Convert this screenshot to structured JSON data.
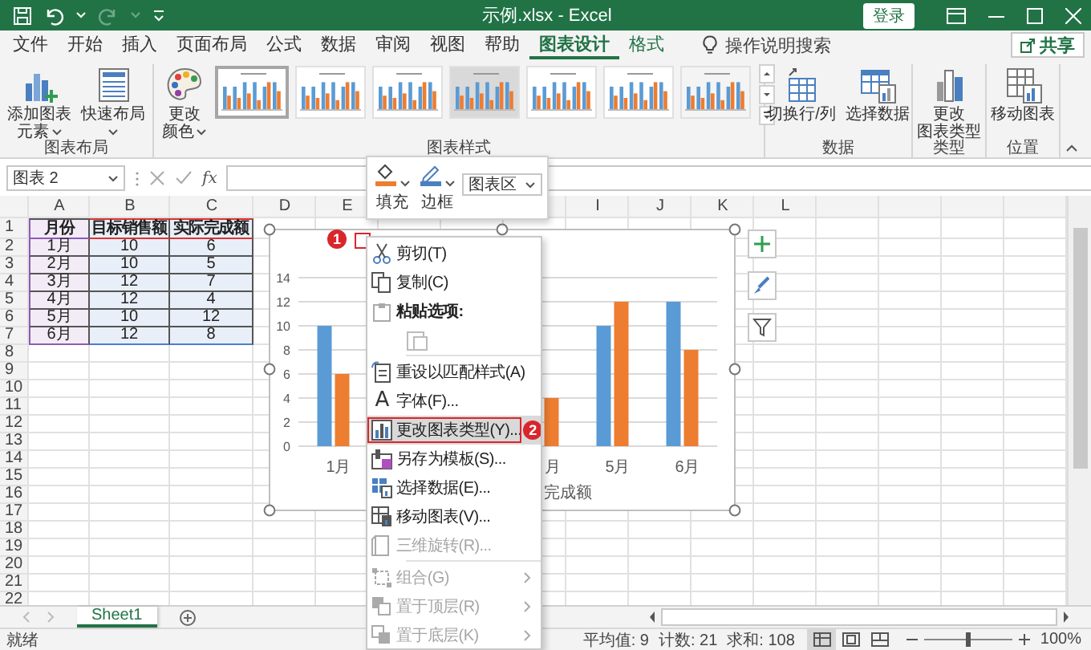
{
  "window": {
    "title": "示例.xlsx - Excel",
    "sign_in": "登录"
  },
  "ribbon_tabs": [
    {
      "label": "文件",
      "selected": false,
      "contextual": false
    },
    {
      "label": "开始",
      "selected": false,
      "contextual": false
    },
    {
      "label": "插入",
      "selected": false,
      "contextual": false
    },
    {
      "label": "页面布局",
      "selected": false,
      "contextual": false
    },
    {
      "label": "公式",
      "selected": false,
      "contextual": false
    },
    {
      "label": "数据",
      "selected": false,
      "contextual": false
    },
    {
      "label": "审阅",
      "selected": false,
      "contextual": false
    },
    {
      "label": "视图",
      "selected": false,
      "contextual": false
    },
    {
      "label": "帮助",
      "selected": false,
      "contextual": false
    },
    {
      "label": "图表设计",
      "selected": true,
      "contextual": true
    },
    {
      "label": "格式",
      "selected": false,
      "contextual": true
    }
  ],
  "tell_me": "操作说明搜索",
  "share_button": "共享",
  "ribbon_groups": [
    {
      "label": "图表布局",
      "buttons": [
        {
          "label_lines": [
            "添加图表",
            "元素"
          ],
          "dropdown": true
        },
        {
          "label_lines": [
            "快速布局"
          ],
          "dropdown": true
        }
      ]
    },
    {
      "label": "图表样式",
      "buttons": [
        {
          "label_lines": [
            "更改",
            "颜色"
          ],
          "dropdown": true
        }
      ],
      "styles": [
        {
          "selected": true
        },
        {
          "selected": false
        },
        {
          "selected": false
        },
        {
          "selected": false
        },
        {
          "selected": false
        },
        {
          "selected": false
        },
        {
          "selected": false
        }
      ]
    },
    {
      "label": "数据",
      "buttons": [
        {
          "label_lines": [
            "切换行/列"
          ],
          "dropdown": false
        },
        {
          "label_lines": [
            "选择数据"
          ],
          "dropdown": false
        }
      ]
    },
    {
      "label": "类型",
      "buttons": [
        {
          "label_lines": [
            "更改",
            "图表类型"
          ],
          "dropdown": false
        }
      ]
    },
    {
      "label": "位置",
      "buttons": [
        {
          "label_lines": [
            "移动图表"
          ],
          "dropdown": false
        }
      ]
    }
  ],
  "formula_bar": {
    "name_box": "图表 2",
    "fx": "fx"
  },
  "mini_toolbar": {
    "buttons": [
      {
        "label": "填充"
      },
      {
        "label": "边框"
      }
    ],
    "dropdown": "图表区"
  },
  "sheet": {
    "column_headers_left": [
      "A",
      "B",
      "C",
      "D",
      "E"
    ],
    "column_headers_right": [
      "I",
      "J",
      "K",
      "L"
    ],
    "row_headers": [
      "1",
      "2",
      "3",
      "4",
      "5",
      "6",
      "7",
      "8",
      "9",
      "10",
      "11",
      "12",
      "13",
      "14",
      "15",
      "16",
      "17",
      "18",
      "19",
      "20",
      "21",
      "22"
    ],
    "table": {
      "header": [
        "月份",
        "目标销售额",
        "实际完成额"
      ],
      "rows": [
        [
          "1月",
          "10",
          "6"
        ],
        [
          "2月",
          "10",
          "5"
        ],
        [
          "3月",
          "12",
          "7"
        ],
        [
          "4月",
          "12",
          "4"
        ],
        [
          "5月",
          "10",
          "12"
        ],
        [
          "6月",
          "12",
          "8"
        ]
      ]
    }
  },
  "chart": {
    "step_badge": "1",
    "chart_data": {
      "type": "bar",
      "categories": [
        "1月",
        null,
        null,
        "月",
        "5月",
        "6月"
      ],
      "series": [
        {
          "color": "#5b9bd5",
          "values": [
            10,
            null,
            null,
            null,
            10,
            12
          ]
        },
        {
          "name": "完成额",
          "color": "#ed7d31",
          "values": [
            6,
            null,
            null,
            4,
            12,
            8
          ]
        }
      ],
      "ylim": [
        0,
        14
      ],
      "yticks": [
        0,
        2,
        4,
        6,
        8,
        10,
        12,
        14
      ],
      "grid": true
    }
  },
  "context_menu": {
    "items": [
      {
        "kind": "item",
        "label": "剪切(T)",
        "disabled": false,
        "highlighted": false,
        "submenu": false
      },
      {
        "kind": "item",
        "label": "复制(C)",
        "disabled": false,
        "highlighted": false,
        "submenu": false
      },
      {
        "kind": "header",
        "label": "粘贴选项:"
      },
      {
        "kind": "paste-options",
        "disabled": true
      },
      {
        "kind": "separator"
      },
      {
        "kind": "item",
        "label": "重设以匹配样式(A)",
        "disabled": false,
        "highlighted": false,
        "submenu": false
      },
      {
        "kind": "item",
        "label": "字体(F)...",
        "icon_char": "A",
        "disabled": false,
        "highlighted": false,
        "submenu": false
      },
      {
        "kind": "item",
        "label": "更改图表类型(Y)...",
        "disabled": false,
        "highlighted": true,
        "submenu": false,
        "step_badge": "2"
      },
      {
        "kind": "item",
        "label": "另存为模板(S)...",
        "disabled": false,
        "highlighted": false,
        "submenu": false
      },
      {
        "kind": "item",
        "label": "选择数据(E)...",
        "disabled": false,
        "highlighted": false,
        "submenu": false
      },
      {
        "kind": "item",
        "label": "移动图表(V)...",
        "disabled": false,
        "highlighted": false,
        "submenu": false
      },
      {
        "kind": "item",
        "label": "三维旋转(R)...",
        "disabled": true,
        "highlighted": false,
        "submenu": false
      },
      {
        "kind": "separator"
      },
      {
        "kind": "item",
        "label": "组合(G)",
        "disabled": true,
        "highlighted": false,
        "submenu": true
      },
      {
        "kind": "item",
        "label": "置于顶层(R)",
        "disabled": true,
        "highlighted": false,
        "submenu": true
      },
      {
        "kind": "item",
        "label": "置于底层(K)",
        "disabled": true,
        "highlighted": false,
        "submenu": true
      }
    ]
  },
  "sheet_tabs": [
    {
      "label": "Sheet1",
      "selected": true
    }
  ],
  "status_bar": {
    "mode": "就绪",
    "stats": [
      "平均值: 9",
      "计数: 21",
      "求和: 108"
    ],
    "views": [
      {
        "selected": true
      },
      {
        "selected": false
      },
      {
        "selected": false
      }
    ],
    "zoom": {
      "level": 0.5,
      "reading": "100%"
    }
  }
}
